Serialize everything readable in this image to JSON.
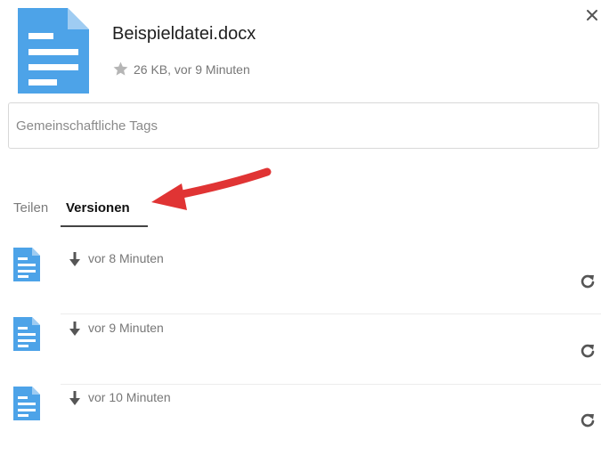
{
  "file": {
    "name": "Beispieldatei.docx",
    "meta": "26 KB, vor 9 Minuten"
  },
  "tags": {
    "placeholder": "Gemeinschaftliche Tags"
  },
  "tabs": [
    {
      "label": "Teilen",
      "active": false
    },
    {
      "label": "Versionen",
      "active": true
    }
  ],
  "versions": [
    {
      "time": "vor 8 Minuten"
    },
    {
      "time": "vor 9 Minuten"
    },
    {
      "time": "vor 10 Minuten"
    }
  ],
  "icons": {
    "file": "document-icon",
    "favorite": "star-icon",
    "close": "close-icon",
    "download": "download-arrow-icon",
    "restore": "restore-icon",
    "annotation": "red-arrow"
  },
  "colors": {
    "file_icon": "#4da3e8",
    "annotation_arrow": "#e03434",
    "tab_underline": "#444444"
  }
}
